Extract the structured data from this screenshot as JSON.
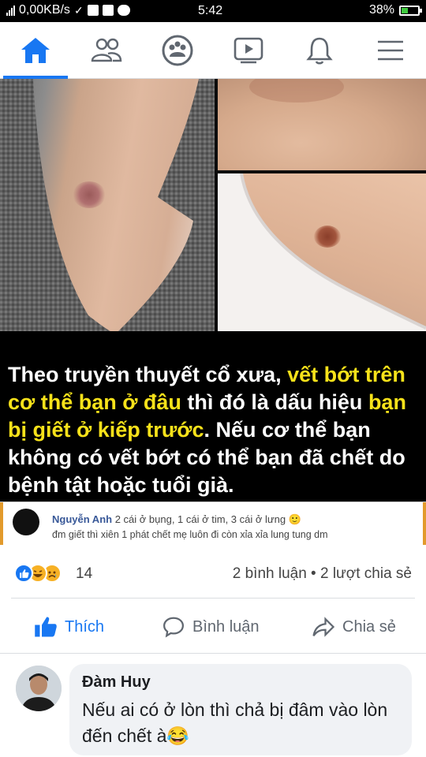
{
  "status_bar": {
    "network": "0,00KB/s",
    "time": "5:42",
    "battery": "38%",
    "battery_level": 0.38
  },
  "nav": {
    "items": [
      {
        "name": "home",
        "icon": "home-icon",
        "active": true
      },
      {
        "name": "friends",
        "icon": "friends-icon",
        "active": false
      },
      {
        "name": "groups",
        "icon": "groups-icon",
        "active": false
      },
      {
        "name": "watch",
        "icon": "video-icon",
        "active": false
      },
      {
        "name": "notifications",
        "icon": "bell-icon",
        "active": false
      },
      {
        "name": "menu",
        "icon": "menu-icon",
        "active": false
      }
    ],
    "accent": "#1877f2"
  },
  "post": {
    "caption": {
      "p1": "Theo truyền thuyết cổ xưa, ",
      "h1": "vết bớt trên cơ thể bạn ở đâu",
      "p2": " thì đó là dấu hiệu ",
      "h2": "bạn bị giết ở kiếp trước",
      "p3": ". Nếu cơ thể bạn không có vết bớt có thể bạn đã chết do bệnh tật hoặc tuổi già.",
      "highlight_color": "#f7e21a"
    },
    "embedded_comment": {
      "author": "Nguyễn Anh",
      "line1": " 2 cái ở bụng, 1 cái ở tim, 3 cái ở lưng ",
      "line2": "đm giết thì xiên 1 phát chết mẹ luôn đi còn xỉa xỉa lung tung dm"
    },
    "reactions": {
      "icons": [
        "like-icon",
        "haha-icon",
        "sad-icon"
      ],
      "count": "14"
    },
    "comments_shares": "2 bình luận • 2 lượt chia sẻ",
    "actions": {
      "like": "Thích",
      "comment": "Bình luận",
      "share": "Chia sẻ"
    }
  },
  "comment": {
    "author": "Đàm Huy",
    "text": "Nếu ai có ở lòn thì chả bị đâm vào lòn đến chết à",
    "emoji": "😂"
  }
}
